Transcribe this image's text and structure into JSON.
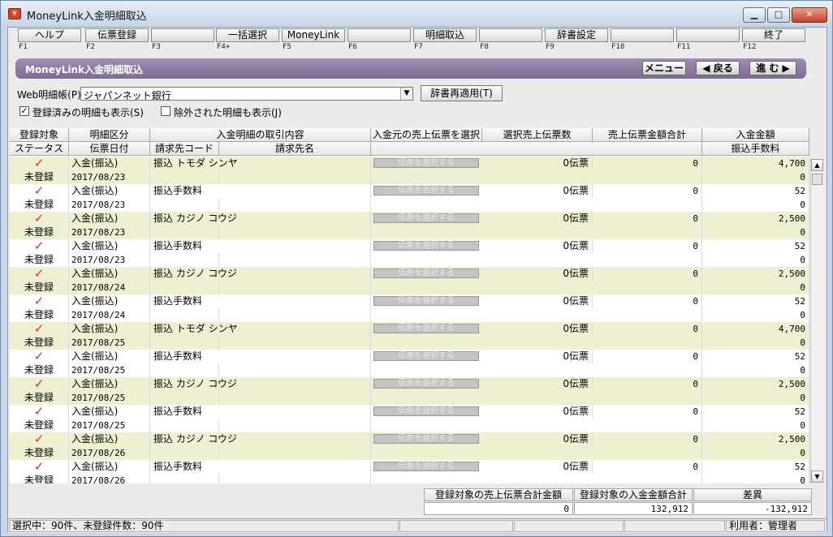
{
  "window": {
    "title": "MoneyLink入金明細取込",
    "icon": "app-icon"
  },
  "fkeys": [
    {
      "label": "ヘルプ",
      "code": "F1"
    },
    {
      "label": "伝票登録",
      "code": "F2"
    },
    {
      "label": "",
      "code": "F3"
    },
    {
      "label": "一括選択",
      "code": "F4+"
    },
    {
      "label": "MoneyLink",
      "code": "F5"
    },
    {
      "label": "",
      "code": "F6"
    },
    {
      "label": "明細取込",
      "code": "F7"
    },
    {
      "label": "",
      "code": "F8"
    },
    {
      "label": "辞書設定",
      "code": "F9"
    },
    {
      "label": "",
      "code": "F10"
    },
    {
      "label": "",
      "code": "F11"
    },
    {
      "label": "終了",
      "code": "F12"
    }
  ],
  "band": {
    "title": "MoneyLink入金明細取込",
    "menu": "メニュー",
    "back": "◀ 戻る",
    "next": "進 む ▶"
  },
  "filter": {
    "account_label": "Web明細帳(P)",
    "account_value": "ジャパンネット銀行",
    "reapply_label": "辞書再適用(T)",
    "show_registered_label": "登録済みの明細も表示(S)",
    "show_registered_checked": true,
    "show_excluded_label": "除外された明細も表示(J)",
    "show_excluded_checked": false
  },
  "grid": {
    "headers_top": [
      "登録対象",
      "明細区分",
      "入金明細の取引内容",
      "入金元の売上伝票を選択",
      "選択売上伝票数",
      "売上伝票金額合計",
      "入金金額"
    ],
    "headers_bottom": [
      "ステータス",
      "伝票日付",
      "請求先コード",
      "請求先名",
      "",
      "振込手数料"
    ],
    "select_button_label": "伝票を選択する",
    "rows": [
      {
        "status": "未登録",
        "type": "入金(振込)",
        "date": "2017/08/23",
        "content": "振込 トモダ  シンヤ",
        "count": "0伝票",
        "total": "0",
        "amount": "4,700",
        "fee": "0"
      },
      {
        "status": "未登録",
        "type": "入金(振込)",
        "date": "2017/08/23",
        "content": "振込手数料",
        "count": "0伝票",
        "total": "0",
        "amount": "52",
        "fee": "0"
      },
      {
        "status": "未登録",
        "type": "入金(振込)",
        "date": "2017/08/23",
        "content": "振込 カジノ  コウジ",
        "count": "0伝票",
        "total": "0",
        "amount": "2,500",
        "fee": "0"
      },
      {
        "status": "未登録",
        "type": "入金(振込)",
        "date": "2017/08/23",
        "content": "振込手数料",
        "count": "0伝票",
        "total": "0",
        "amount": "52",
        "fee": "0"
      },
      {
        "status": "未登録",
        "type": "入金(振込)",
        "date": "2017/08/24",
        "content": "振込 カジノ  コウジ",
        "count": "0伝票",
        "total": "0",
        "amount": "2,500",
        "fee": "0"
      },
      {
        "status": "未登録",
        "type": "入金(振込)",
        "date": "2017/08/24",
        "content": "振込手数料",
        "count": "0伝票",
        "total": "0",
        "amount": "52",
        "fee": "0"
      },
      {
        "status": "未登録",
        "type": "入金(振込)",
        "date": "2017/08/25",
        "content": "振込 トモダ  シンヤ",
        "count": "0伝票",
        "total": "0",
        "amount": "4,700",
        "fee": "0"
      },
      {
        "status": "未登録",
        "type": "入金(振込)",
        "date": "2017/08/25",
        "content": "振込手数料",
        "count": "0伝票",
        "total": "0",
        "amount": "52",
        "fee": "0"
      },
      {
        "status": "未登録",
        "type": "入金(振込)",
        "date": "2017/08/25",
        "content": "振込 カジノ  コウジ",
        "count": "0伝票",
        "total": "0",
        "amount": "2,500",
        "fee": "0"
      },
      {
        "status": "未登録",
        "type": "入金(振込)",
        "date": "2017/08/25",
        "content": "振込手数料",
        "count": "0伝票",
        "total": "0",
        "amount": "52",
        "fee": "0"
      },
      {
        "status": "未登録",
        "type": "入金(振込)",
        "date": "2017/08/26",
        "content": "振込 カジノ  コウジ",
        "count": "0伝票",
        "total": "0",
        "amount": "2,500",
        "fee": "0"
      },
      {
        "status": "未登録",
        "type": "入金(振込)",
        "date": "2017/08/26",
        "content": "振込手数料",
        "count": "0伝票",
        "total": "0",
        "amount": "52",
        "fee": "0"
      }
    ]
  },
  "totals": {
    "sales_label": "登録対象の売上伝票合計金額",
    "sales_value": "0",
    "deposit_label": "登録対象の入金金額合計",
    "deposit_value": "132,912",
    "diff_label": "差異",
    "diff_value": "-132,912"
  },
  "status": {
    "selection": "選択中：90件、未登録件数：90件",
    "user": "利用者：管理者"
  },
  "colors": {
    "band": "#8a7aa2",
    "row_alt": "#efefd2",
    "check": "#d2342a"
  }
}
